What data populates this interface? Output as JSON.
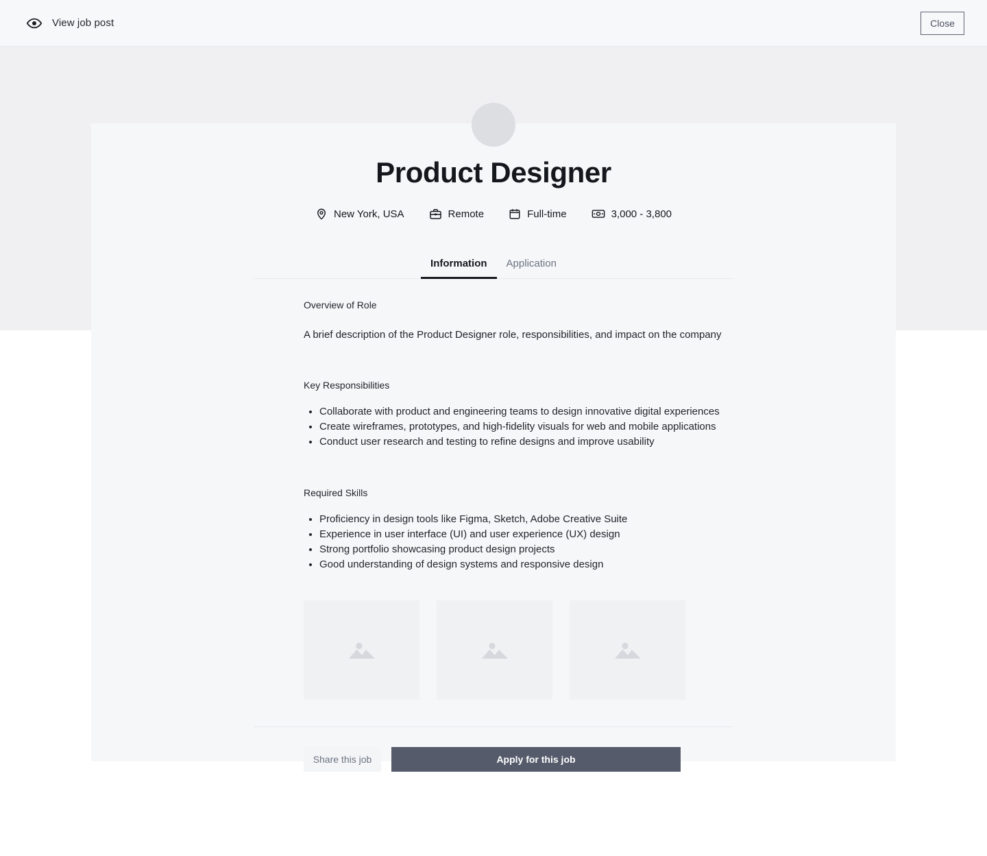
{
  "topbar": {
    "eye_icon": "eye-icon",
    "title": "View job post",
    "close_label": "Close"
  },
  "job": {
    "title": "Product Designer",
    "meta": [
      {
        "icon": "location-pin-icon",
        "label": "New York, USA"
      },
      {
        "icon": "briefcase-icon",
        "label": "Remote"
      },
      {
        "icon": "calendar-icon",
        "label": "Full-time"
      },
      {
        "icon": "money-icon",
        "label": "3,000 - 3,800"
      }
    ]
  },
  "tabs": [
    {
      "label": "Information",
      "active": true
    },
    {
      "label": "Application",
      "active": false
    }
  ],
  "sections": {
    "overview_heading": "Overview of Role",
    "overview_text": "A brief description of the Product Designer role, responsibilities, and impact on the company",
    "responsibilities_heading": "Key Responsibilities",
    "responsibilities": [
      "Collaborate with product and engineering teams to design innovative digital experiences",
      "Create wireframes, prototypes, and high-fidelity visuals for web and mobile applications",
      "Conduct user research and testing to refine designs and improve usability"
    ],
    "skills_heading": "Required Skills",
    "skills": [
      "Proficiency in design tools like Figma, Sketch, Adobe Creative Suite",
      "Experience in user interface (UI) and user experience (UX) design",
      "Strong portfolio showcasing product design projects",
      "Good understanding of design systems and responsive design"
    ]
  },
  "gallery": [
    {
      "icon": "image-placeholder-icon"
    },
    {
      "icon": "image-placeholder-icon"
    },
    {
      "icon": "image-placeholder-icon"
    }
  ],
  "footer": {
    "share_label": "Share this job",
    "apply_label": "Apply for this job"
  },
  "colors": {
    "page_bg": "#ffffff",
    "topbar_bg": "#f7f8fa",
    "banner_bg": "#f0f0f2",
    "card_bg": "#f6f7f9",
    "text_primary": "#14171c",
    "text_muted": "#6b7280",
    "accent_button": "#555b6b",
    "divider": "#e7e9ec"
  }
}
